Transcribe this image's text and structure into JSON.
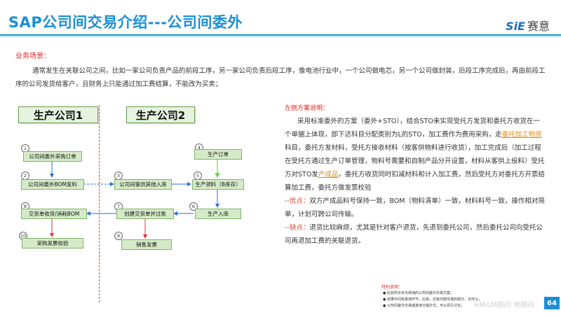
{
  "header": {
    "title": "SAP公司间交易介绍---公司间委外",
    "logo_mark": "SiE",
    "logo_text": "赛意"
  },
  "scenario": {
    "label": "业务场景：",
    "text": "通常发生在关联公司之间，比如一家公司负责产品的前段工序，另一家公司负责后段工序，像电池行业中，一个公司做电芯，另一个公司做封装，后段工序完成后，再由前段工序的公司发货给客户，且财务上只能通过加工费结算，不能改为买卖；"
  },
  "diagram": {
    "company1": "生产公司1",
    "company2": "生产公司2",
    "steps": [
      {
        "num": "1",
        "label": "公司间委外采购订单"
      },
      {
        "num": "2",
        "label": "公司间委外BOM发料"
      },
      {
        "num": "3",
        "label": "公司间客供其他入库"
      },
      {
        "num": "4",
        "label": "生产订单"
      },
      {
        "num": "5",
        "label": "生产领料（B库存）"
      },
      {
        "num": "6",
        "label": "生产入库"
      },
      {
        "num": "7",
        "label": "创建交货单并过账"
      },
      {
        "num": "8",
        "label": "交货单收货/消耗BOM"
      },
      {
        "num": "9",
        "label": "销售发票"
      },
      {
        "num": "10",
        "label": "采购发票校验"
      }
    ]
  },
  "plan": {
    "label": "左侧方案说明：",
    "p1_a": "采用标准委外的方案（委外+STO），结合STO来实现受托方发货和委托方收货在一个单据上体现，即下达科目分配类别为L的STO，加工费作为费用采购，走",
    "p1_link1": "委托加工物资",
    "p1_b": "科目，委托方发材料，受托方接收材料（按客供物料进行收货），加工完成后（加工过程在受托方通过生产订单管理，物料号需要和自制产品分开设置，材料从客供上投料）受托方对STO发",
    "p1_link2": "产成品",
    "p1_c": "，委托方收货同时扣减材料和计入加工费，然后受托方对委托方开票结算加工费，委托方做发票校验",
    "pros_label": "--优点：",
    "pros_text": "双方产成品料号保持一致，BOM（物料清单）一致，材料料号一致，操作相对简单，计划可跨公司传输。",
    "cons_label": "--缺点：",
    "cons_text": "退货比较麻烦，尤其是针对客户退货，先退到委托公司，然后委托公司向受托公司再退加工费的关联退货。"
  },
  "notes": {
    "title": "特别说明：",
    "items": [
      "此处所示仅为单纯的公司间委外交易方案；",
      "如果中间有其他环节，比如，还有内部交易的部分，也可以；",
      "公司间委外交易或其他分销方式，可以另行讨论；"
    ]
  },
  "footer": {
    "watermark": "HMOM顾问 帅顾问",
    "page": "64"
  }
}
